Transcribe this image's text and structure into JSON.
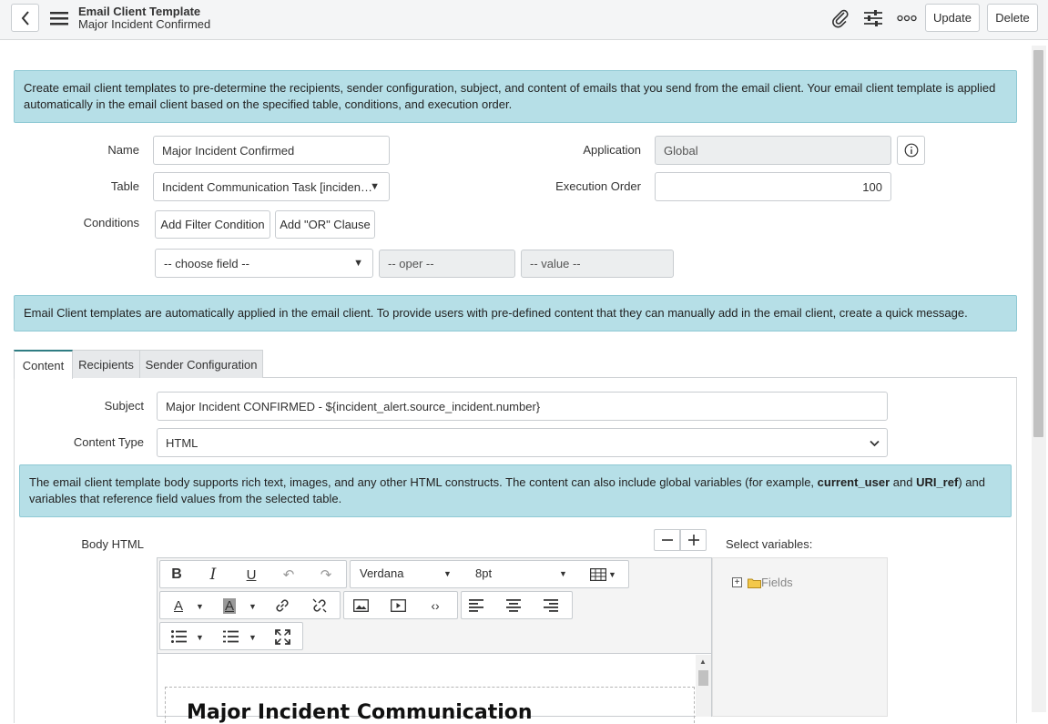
{
  "header": {
    "title": "Email Client Template",
    "subtitle": "Major Incident Confirmed",
    "update_label": "Update",
    "delete_label": "Delete"
  },
  "intro_info": "Create email client templates to pre-determine the recipients, sender configuration, subject, and content of emails that you send from the email client. Your email client template is applied automatically in the email client based on the specified table, conditions, and execution order.",
  "form": {
    "name_label": "Name",
    "name_value": "Major Incident Confirmed",
    "table_label": "Table",
    "table_value": "Incident Communication Task [inciden…",
    "conditions_label": "Conditions",
    "add_filter_label": "Add Filter Condition",
    "add_or_label": "Add \"OR\" Clause",
    "choose_field": "-- choose field --",
    "oper": "-- oper --",
    "value": "-- value --",
    "application_label": "Application",
    "application_value": "Global",
    "execution_order_label": "Execution Order",
    "execution_order_value": "100"
  },
  "quick_message_info": "Email Client templates are automatically applied in the email client. To provide users with pre-defined content that they can manually add in the email client, create a quick message.",
  "tabs": [
    {
      "label": "Content"
    },
    {
      "label": "Recipients"
    },
    {
      "label": "Sender Configuration"
    }
  ],
  "content": {
    "subject_label": "Subject",
    "subject_value": "Major Incident CONFIRMED - ${incident_alert.source_incident.number}",
    "content_type_label": "Content Type",
    "content_type_value": "HTML",
    "body_info_part1": "The email client template body supports rich text, images, and any other HTML constructs. The content can also include global variables (for example, ",
    "body_info_var1": "current_user",
    "body_info_and": " and ",
    "body_info_var2": "URI_ref",
    "body_info_part2": ") and variables that reference field values from the selected table.",
    "body_html_label": "Body HTML",
    "font_family": "Verdana",
    "font_size": "8pt",
    "select_variables_label": "Select variables:",
    "fields_label": "Fields",
    "editor_heading": "Major Incident Communication"
  },
  "colors": {
    "info_bg": "#b6dfe7",
    "tab_accent": "#2f7d83",
    "header_bg": "#f4f5f6"
  }
}
